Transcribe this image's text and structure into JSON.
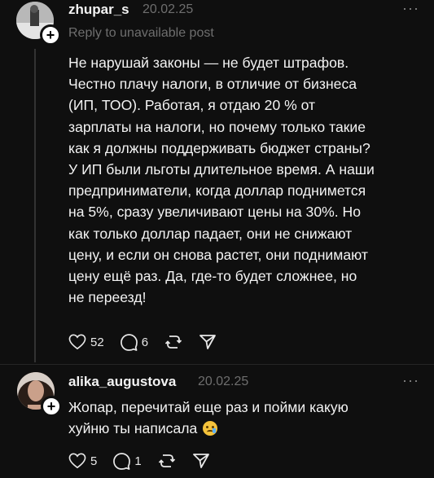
{
  "comment1": {
    "username": "zhupar_s",
    "date": "20.02.25",
    "reply_note": "Reply to unavailable post",
    "text": "Не нарушай законы — не будет штрафов.\nЧестно плачу налоги, в отличие от бизнеса\n(ИП, ТОО). Работая, я отдаю 20 % от\nзарплаты на налоги, но почему только такие\nкак я должны поддерживать бюджет страны?\nУ ИП были льготы длительное время. А наши\nпредприниматели, когда доллар поднимется\nна 5%, сразу увеличивают цены на 30%. Но\nкак только доллар падает, они не снижают\nцену, и если он снова растет, они поднимают\nцену ещё раз. Да, где-то будет сложнее, но\nне переезд!",
    "likes": "52",
    "replies": "6",
    "more": "···"
  },
  "comment2": {
    "username": "alika_augustova",
    "date": "20.02.25",
    "text_line1": "Жопар, перечитай еще раз и пойми какую",
    "text_line2": "хуйню ты написала",
    "emoji": "crying-face",
    "likes": "5",
    "replies": "1",
    "more": "···"
  },
  "icons": {
    "like": "heart-icon",
    "reply": "comment-bubble-icon",
    "repost": "repost-icon",
    "share": "send-icon",
    "follow": "plus-icon"
  }
}
